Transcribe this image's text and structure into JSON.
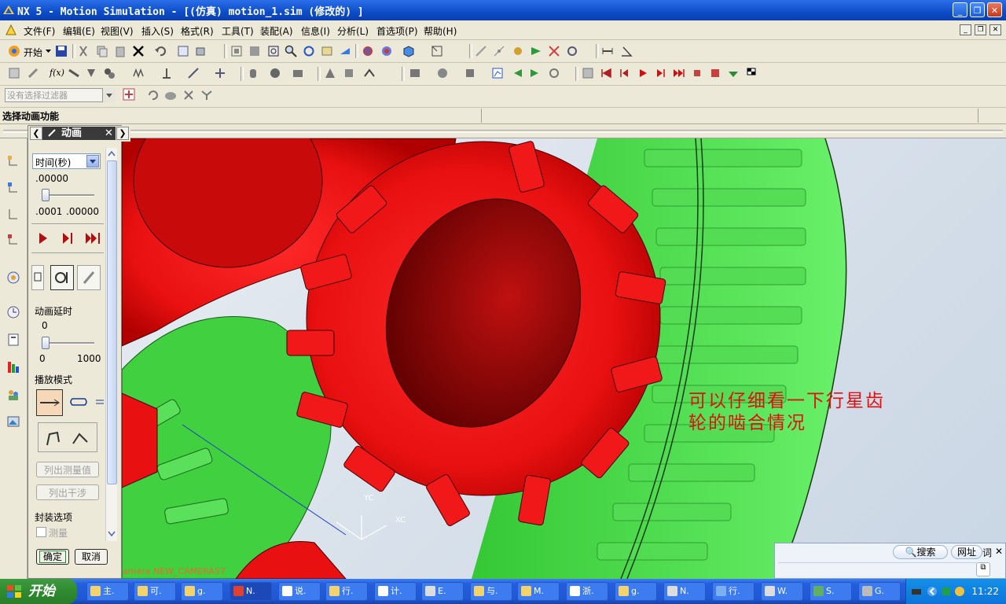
{
  "window": {
    "title": "NX 5 - Motion Simulation - [(仿真) motion_1.sim  (修改的) ]"
  },
  "menubar": {
    "items": [
      "文件(F)",
      "编辑(E)",
      "视图(V)",
      "插入(S)",
      "格式(R)",
      "工具(T)",
      "装配(A)",
      "信息(I)",
      "分析(L)",
      "首选项(P)",
      "帮助(H)"
    ]
  },
  "toolbar": {
    "start_label": "开始"
  },
  "filter": {
    "placeholder": "没有选择过滤器"
  },
  "cue": {
    "text": "选择动画功能"
  },
  "panel": {
    "title": "动画",
    "time_select": "时间(秒)",
    "time_value": ".00000",
    "time_min": ".0001",
    "time_max": ".00000",
    "delay_label": "动画延时",
    "delay_value": "0",
    "delay_min": "0",
    "delay_max": "1000",
    "playmode_label": "播放模式",
    "list_measure": "列出测量值",
    "list_interference": "列出干涉",
    "envelope_label": "封装选项",
    "measure_checkbox": "测量",
    "ok": "确定",
    "cancel": "取消"
  },
  "viewport": {
    "annotation_line1": "可以仔细看一下行星齿",
    "annotation_line2": "轮的啮合情况",
    "camera_label": "amera NEW_CAMERA57",
    "axis_yc": "YC",
    "axis_xc": "XC",
    "axis_zc": "ZC"
  },
  "searchbar": {
    "search": "搜索",
    "url": "网址",
    "word": "词"
  },
  "taskbar": {
    "start": "开始",
    "tasks": [
      "主.",
      "可.",
      "g.",
      "N.",
      "说.",
      "行.",
      "计.",
      "E.",
      "与.",
      "M.",
      "浙.",
      "g.",
      "N.",
      "行.",
      "W.",
      "S.",
      "G."
    ],
    "clock": "11:22"
  },
  "colors": {
    "gear_red": "#e81010",
    "gear_green": "#3fdc3f",
    "titlebar": "#0d4cc8",
    "taskbar": "#245edc"
  }
}
